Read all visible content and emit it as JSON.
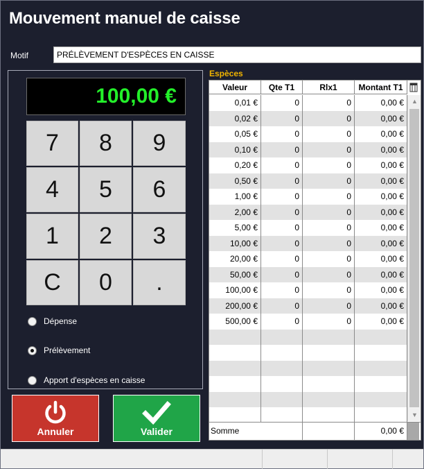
{
  "window": {
    "title": "Mouvement manuel de caisse"
  },
  "motif": {
    "label": "Motif",
    "value": "PRÉLÈVEMENT D'ESPÈCES EN CAISSE"
  },
  "display": {
    "amount": "100,00 €"
  },
  "keypad": {
    "keys": [
      "7",
      "8",
      "9",
      "4",
      "5",
      "6",
      "1",
      "2",
      "3",
      "C",
      "0",
      "."
    ]
  },
  "options": [
    {
      "label": "Dépense",
      "checked": false
    },
    {
      "label": "Prélèvement",
      "checked": true
    },
    {
      "label": "Apport d'espèces en caisse",
      "checked": false
    }
  ],
  "buttons": {
    "cancel_label": "Annuler",
    "validate_label": "Valider"
  },
  "grid": {
    "section_label": "Espèces",
    "columns": [
      "Valeur",
      "Qte T1",
      "Rlx1",
      "Montant T1"
    ],
    "rows": [
      [
        "0,01 €",
        "0",
        "0",
        "0,00 €"
      ],
      [
        "0,02 €",
        "0",
        "0",
        "0,00 €"
      ],
      [
        "0,05 €",
        "0",
        "0",
        "0,00 €"
      ],
      [
        "0,10 €",
        "0",
        "0",
        "0,00 €"
      ],
      [
        "0,20 €",
        "0",
        "0",
        "0,00 €"
      ],
      [
        "0,50 €",
        "0",
        "0",
        "0,00 €"
      ],
      [
        "1,00 €",
        "0",
        "0",
        "0,00 €"
      ],
      [
        "2,00 €",
        "0",
        "0",
        "0,00 €"
      ],
      [
        "5,00 €",
        "0",
        "0",
        "0,00 €"
      ],
      [
        "10,00 €",
        "0",
        "0",
        "0,00 €"
      ],
      [
        "20,00 €",
        "0",
        "0",
        "0,00 €"
      ],
      [
        "50,00 €",
        "0",
        "0",
        "0,00 €"
      ],
      [
        "100,00 €",
        "0",
        "0",
        "0,00 €"
      ],
      [
        "200,00 €",
        "0",
        "0",
        "0,00 €"
      ],
      [
        "500,00 €",
        "0",
        "0",
        "0,00 €"
      ]
    ],
    "footer": {
      "label": "Somme",
      "total": "0,00 €"
    }
  },
  "colors": {
    "background": "#1c1f2e",
    "accent": "#f0b400",
    "display_text": "#23f02a",
    "cancel": "#c6352c",
    "validate": "#20a548"
  },
  "icons": {
    "cancel": "power-icon",
    "validate": "check-icon",
    "column_chooser": "column-chooser-icon"
  }
}
